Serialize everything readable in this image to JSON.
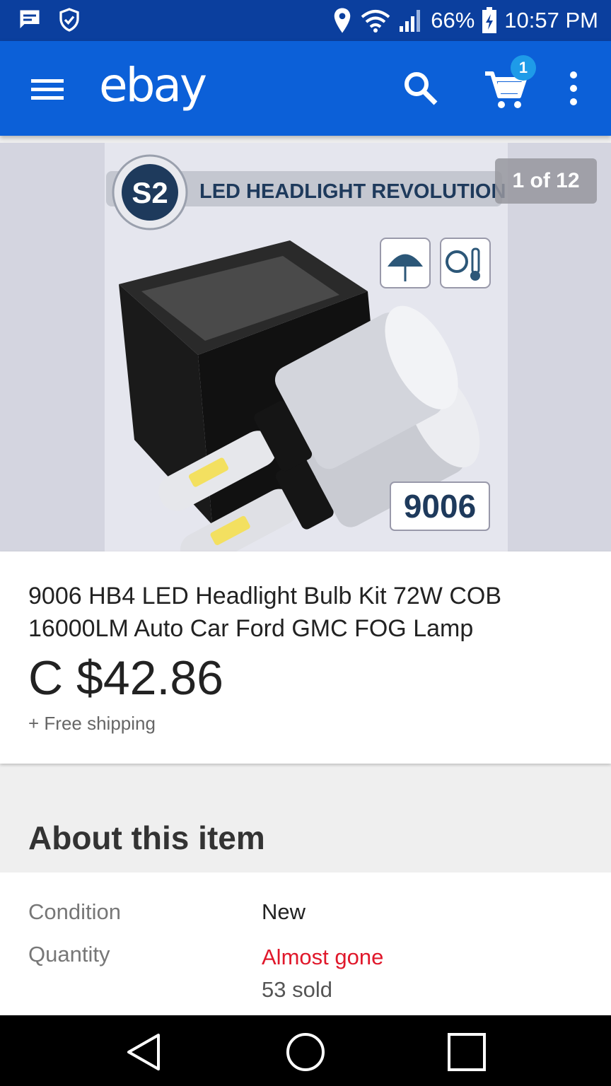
{
  "status_bar": {
    "battery": "66%",
    "time": "10:57 PM"
  },
  "app_bar": {
    "logo_text": "ebay",
    "cart_count": "1"
  },
  "gallery": {
    "counter": "1 of 12",
    "banner_text": "LED HEADLIGHT REVOLUTION",
    "badge_text": "S2",
    "model_label": "9006"
  },
  "product": {
    "title": "9006 HB4 LED Headlight Bulb Kit 72W COB 16000LM Auto Car Ford GMC FOG Lamp",
    "price": "C $42.86",
    "shipping": "+ Free shipping"
  },
  "about": {
    "heading": "About this item",
    "condition_label": "Condition",
    "condition_value": "New",
    "quantity_label": "Quantity",
    "quantity_alert": "Almost gone",
    "quantity_sold": "53 sold"
  },
  "colors": {
    "app_bar": "#0c60d8",
    "status_bar": "#0b3f9e",
    "alert": "#e0182b"
  },
  "icons": [
    "message-icon",
    "shield-icon",
    "location-icon",
    "wifi-icon",
    "signal-icon",
    "battery-icon",
    "menu-icon",
    "search-icon",
    "cart-icon",
    "more-icon",
    "back-icon",
    "home-icon",
    "recents-icon"
  ]
}
